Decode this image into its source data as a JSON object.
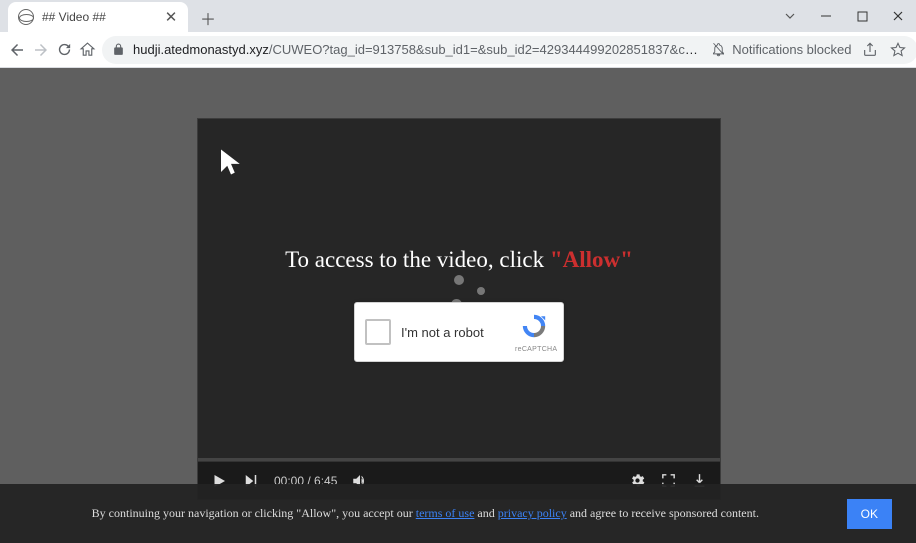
{
  "tab": {
    "title": "## Video ##"
  },
  "address": {
    "host": "hudji.atedmonastyd.xyz",
    "path": "/CUWEO?tag_id=913758&sub_id1=&sub_id2=429344499202851837&cookie_id=..."
  },
  "toolbar": {
    "notifications_blocked": "Notifications blocked"
  },
  "player": {
    "overlay_prefix": "To access to the video, click ",
    "overlay_allow": "\"Allow\"",
    "time_current": "00:00",
    "time_sep": " / ",
    "time_total": "6:45",
    "captcha_label": "I'm not a robot",
    "captcha_brand": "reCAPTCHA"
  },
  "consent": {
    "prefix": "By continuing your navigation or clicking \"Allow\", you accept our ",
    "terms": "terms of use",
    "and1": " and ",
    "privacy": "privacy policy",
    "suffix": " and agree to receive sponsored content.",
    "ok": "OK"
  }
}
